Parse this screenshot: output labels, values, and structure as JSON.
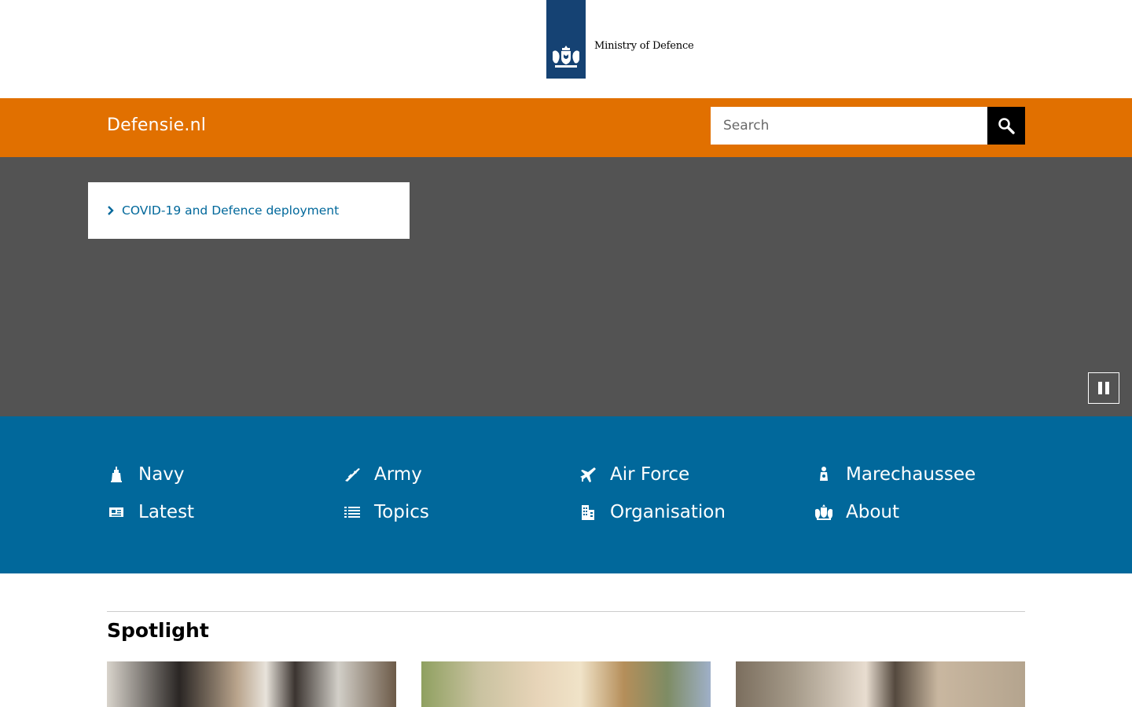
{
  "header": {
    "logo_text": "Ministry of Defence",
    "site_name": "Defensie.nl"
  },
  "search": {
    "placeholder": "Search",
    "value": ""
  },
  "hero": {
    "link_label": "COVID-19 and Defence deployment"
  },
  "nav": {
    "items": [
      {
        "label": "Navy",
        "icon": "navy-icon"
      },
      {
        "label": "Army",
        "icon": "army-icon"
      },
      {
        "label": "Air Force",
        "icon": "air-force-icon"
      },
      {
        "label": "Marechaussee",
        "icon": "marechaussee-icon"
      },
      {
        "label": "Latest",
        "icon": "news-icon"
      },
      {
        "label": "Topics",
        "icon": "list-icon"
      },
      {
        "label": "Organisation",
        "icon": "building-icon"
      },
      {
        "label": "About",
        "icon": "crest-icon"
      }
    ]
  },
  "spotlight": {
    "title": "Spotlight"
  },
  "colors": {
    "brand_blue": "#154273",
    "orange": "#e17000",
    "nav_blue": "#01689b",
    "hero_grey": "#535353",
    "link_blue": "#01689b"
  }
}
